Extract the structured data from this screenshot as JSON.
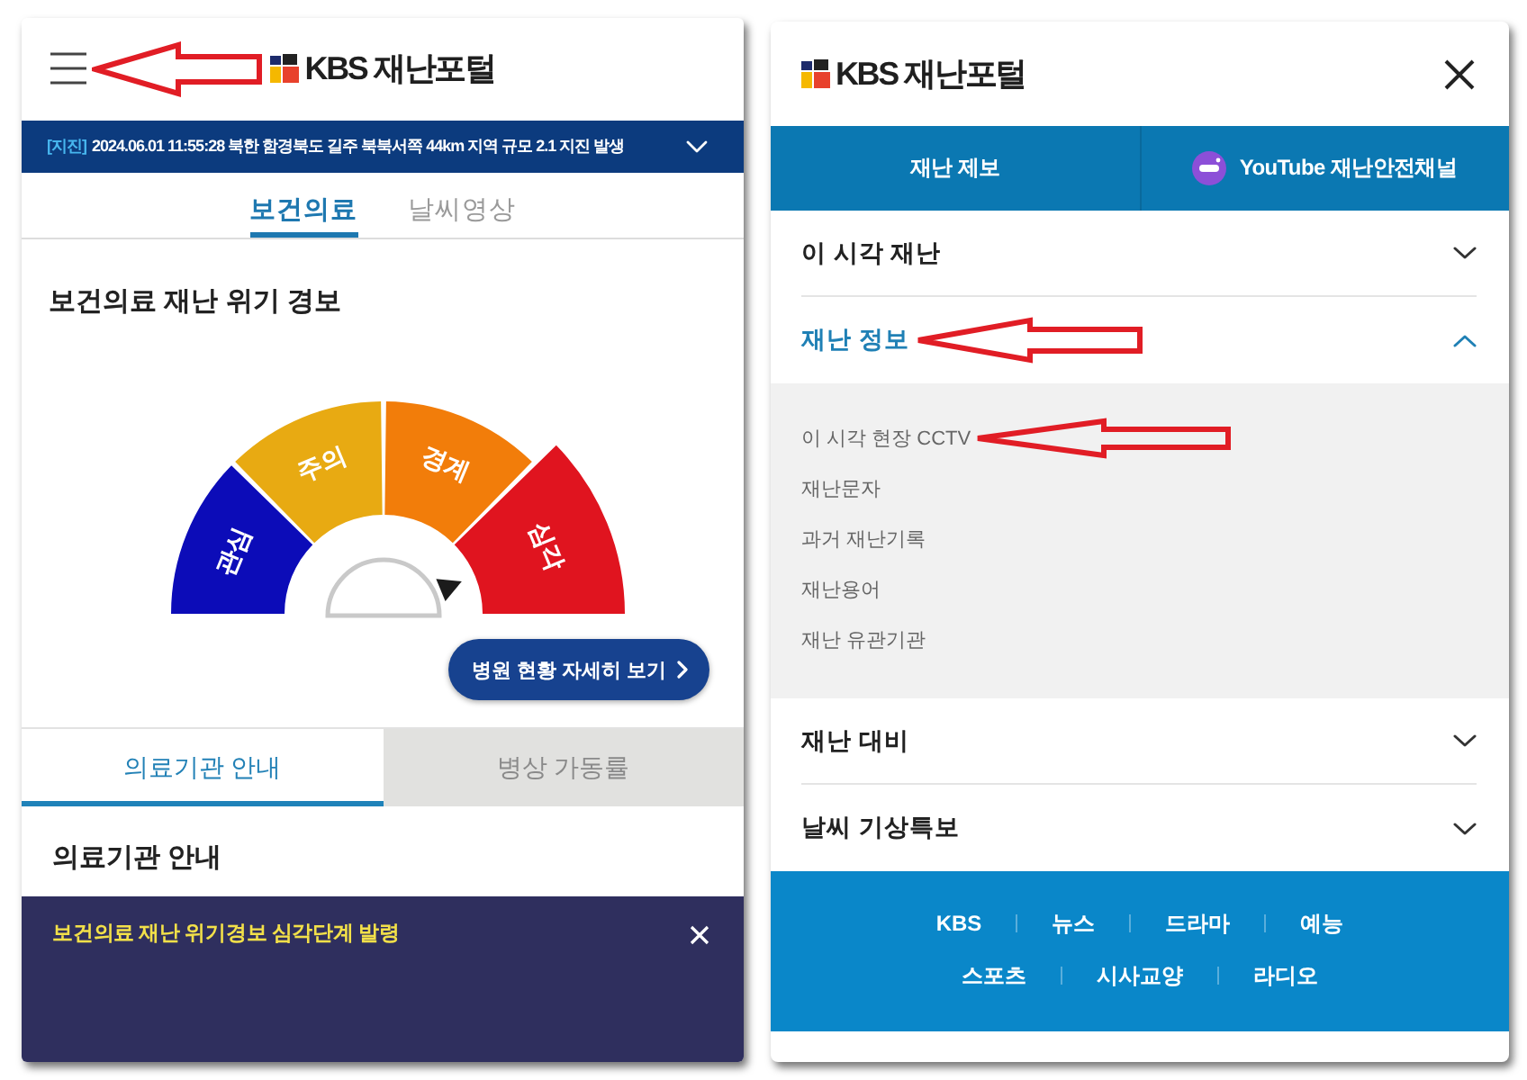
{
  "home_screen": {
    "header": {
      "menu_button": {
        "arrow": true
      },
      "logo": "KBS 재난포털"
    },
    "alert_ticker": {
      "tag": "[지진]",
      "text": "2024.06.01 11:55:28 북한 함경북도 길주 북북서쪽 44km 지역 규모 2.1 지진 발생",
      "expanded": false
    },
    "tabs": [
      {
        "label": "보건의료",
        "selected": true
      },
      {
        "label": "날씨영상",
        "selected": false
      }
    ],
    "alert_level": {
      "title": "보건의료 재난 위기 경보",
      "levels": [
        {
          "label": "관심",
          "color": "#0c0cb8",
          "selected": false
        },
        {
          "label": "주의",
          "color": "#e8aa12",
          "selected": false
        },
        {
          "label": "경계",
          "color": "#f27d0a",
          "selected": false
        },
        {
          "label": "심각",
          "color": "#e0141f",
          "selected": true
        }
      ],
      "detail_button": "병원 현황 자세히 보기"
    },
    "sub_tabs": [
      {
        "label": "의료기관 안내",
        "selected": true
      },
      {
        "label": "병상 가동률",
        "selected": false
      }
    ],
    "section_title": "의료기관 안내",
    "notice_banner": {
      "text": "보건의료 재난 위기경보 심각단계 발령"
    }
  },
  "menu_screen": {
    "logo": "KBS 재난포털",
    "quick_links": [
      {
        "label": "재난 제보",
        "kind": "plain"
      },
      {
        "label": "YouTube 재난안전채널",
        "kind": "channel"
      }
    ],
    "menu": [
      {
        "label": "이 시각 재난",
        "expanded": false,
        "arrow": false
      },
      {
        "label": "재난 정보",
        "expanded": true,
        "arrow": true,
        "children": [
          {
            "label": "이 시각 현장 CCTV",
            "arrow": true
          },
          {
            "label": "재난문자",
            "arrow": false
          },
          {
            "label": "과거 재난기록",
            "arrow": false
          },
          {
            "label": "재난용어",
            "arrow": false
          },
          {
            "label": "재난 유관기관",
            "arrow": false
          }
        ]
      },
      {
        "label": "재난 대비",
        "expanded": false,
        "arrow": false
      },
      {
        "label": "날씨 기상특보",
        "expanded": false,
        "arrow": false
      }
    ],
    "footer_links": [
      [
        "KBS",
        "뉴스",
        "드라마",
        "예능"
      ],
      [
        "스포츠",
        "시사교양",
        "라디오"
      ]
    ]
  }
}
